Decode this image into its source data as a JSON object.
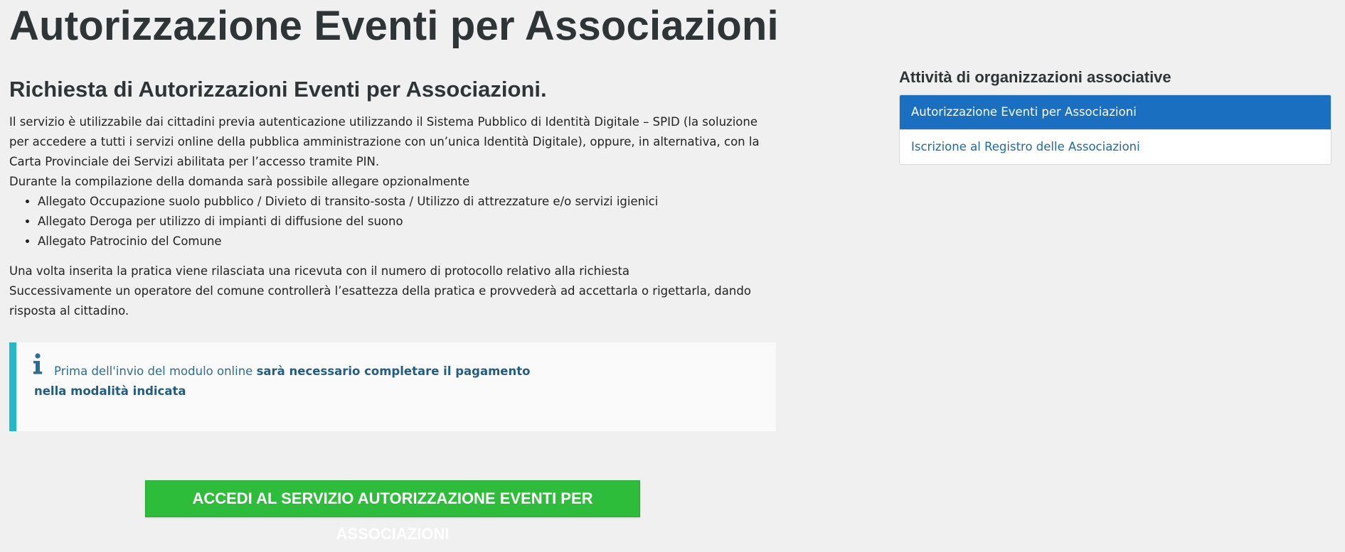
{
  "page": {
    "title": "Autorizzazione Eventi per Associazioni"
  },
  "main": {
    "heading": "Richiesta di Autorizzazioni Eventi per Associazioni.",
    "intro": "Il servizio è utilizzabile dai cittadini previa autenticazione utilizzando il Sistema Pubblico di Identità Digitale – SPID (la soluzione per accedere a tutti i servizi online della pubblica amministrazione con un’unica Identità Digitale), oppure, in alternativa, con la Carta Provinciale dei Servizi abilitata per l’accesso tramite PIN.",
    "attachments_intro": "Durante la compilazione della domanda sarà possibile allegare opzionalmente",
    "attachments": [
      "Allegato Occupazione suolo pubblico / Divieto di transito-sosta / Utilizzo di attrezzature e/o servizi igienici",
      "Allegato Deroga per utilizzo di impianti di diffusione del suono",
      "Allegato Patrocinio del Comune"
    ],
    "receipt_text": "Una volta inserita la pratica viene rilasciata una ricevuta con il numero di protocollo relativo alla richiesta",
    "followup_text": "Successivamente un operatore del comune controllerà l’esattezza della pratica e provvederà ad accettarla o rigettarla, dando risposta al cittadino."
  },
  "info_box": {
    "icon": "info-icon",
    "text_prefix": "Prima dell'invio del modulo online ",
    "text_bold": "sarà necessario completare il pagamento nella modalità indicata",
    "accent_color": "#24b9c8"
  },
  "cta": {
    "label": "ACCEDI AL SERVIZIO AUTORIZZAZIONE EVENTI PER ASSOCIAZIONI",
    "color": "#2ebd3b"
  },
  "sidebar": {
    "title": "Attività di organizzazioni associative",
    "items": [
      {
        "label": "Autorizzazione Eventi per Associazioni",
        "active": true
      },
      {
        "label": "Iscrizione al Registro delle Associazioni",
        "active": false
      }
    ],
    "active_color": "#1a6fc0"
  }
}
